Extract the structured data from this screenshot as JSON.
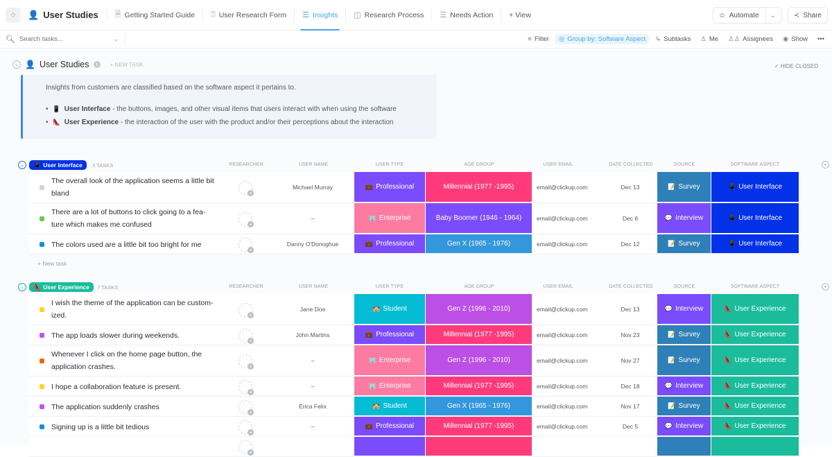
{
  "header": {
    "space_icon": "loading-spinner-icon",
    "title": "User Studies",
    "tabs": [
      {
        "label": "Getting Started Guide",
        "icon": "doc-icon",
        "active": false
      },
      {
        "label": "User Research Form",
        "icon": "form-icon",
        "active": false
      },
      {
        "label": "Insights",
        "icon": "list-icon",
        "active": true
      },
      {
        "label": "Research Process",
        "icon": "board-icon",
        "active": false
      },
      {
        "label": "Needs Action",
        "icon": "list-icon",
        "active": false
      }
    ],
    "add_view": "+ View",
    "automate": "Automate",
    "share": "Share"
  },
  "toolbar": {
    "search_placeholder": "Search tasks...",
    "filter": "Filter",
    "group_by": "Group by: Software Aspect",
    "subtasks": "Subtasks",
    "me": "Me",
    "assignees": "Assignees",
    "show": "Show",
    "more": "•••"
  },
  "list": {
    "title": "User Studies",
    "new_task": "+ NEW TASK",
    "hide_closed": "✓ HIDE CLOSED",
    "description": {
      "intro": "Insights from customers are classified based on the software aspect it pertains to.",
      "items": [
        {
          "icon": "📱",
          "term": "User Interface",
          "text": " - the buttons, images, and other visual items that users interact with when using the software"
        },
        {
          "icon": "👠",
          "term": "User Experience",
          "text": " - the interaction of the user with the product and/or their perceptions about the interaction"
        }
      ]
    }
  },
  "columns": [
    "RESEARCHER",
    "USER NAME",
    "USER TYPE",
    "AGE GROUP",
    "USER EMAIL",
    "DATE COLLECTED",
    "SOURCE",
    "SOFTWARE ASPECT"
  ],
  "colors": {
    "ui_badge": "#0231e8",
    "ux_badge": "#1bbc9c",
    "professional": "#7b4cfb",
    "enterprise": "#fd7ba3",
    "student": "#04bcd3",
    "millennial": "#fe3a7b",
    "baby_boomer": "#7b4cfb",
    "gen_x": "#3397dd",
    "gen_z": "#bb4fe6",
    "survey": "#2f80b8",
    "interview": "#7b4cfb"
  },
  "groups": [
    {
      "name": "User Interface",
      "icon": "📱",
      "count": "3 TASKS",
      "new_task": "+ New task",
      "tasks": [
        {
          "name": "The overall look of the application seems a little bit bland",
          "status_color": "#d3d3d3",
          "user_name": "Michael Murray",
          "user_type": "Professional",
          "user_type_icon": "💼",
          "age_group": "Millennial (1977 -1995)",
          "email": "email@clickup.com",
          "date": "Dec 13",
          "source": "Survey",
          "source_icon": "📝",
          "aspect": "User Interface"
        },
        {
          "name": "There are a lot of buttons to click going to a fea-ture which makes me confused",
          "status_color": "#6bc950",
          "user_name": "–",
          "user_type": "Enterprise",
          "user_type_icon": "🏢",
          "age_group": "Baby Boomer (1946 - 1964)",
          "email": "email@clickup.com",
          "date": "Dec 6",
          "source": "Interview",
          "source_icon": "💬",
          "aspect": "User Interface"
        },
        {
          "name": "The colors used are a little bit too bright for me",
          "status_color": "#1090e0",
          "user_name": "Danny O'Donoghue",
          "user_type": "Professional",
          "user_type_icon": "💼",
          "age_group": "Gen X (1965 - 1976)",
          "email": "email@clickup.com",
          "date": "Dec 12",
          "source": "Survey",
          "source_icon": "📝",
          "aspect": "User Interface"
        }
      ]
    },
    {
      "name": "User Experience",
      "icon": "👠",
      "count": "7 TASKS",
      "tasks": [
        {
          "name": "I wish the theme of the application can be custom-ized.",
          "status_color": "#f8d620",
          "user_name": "Jane Doe",
          "user_type": "Student",
          "user_type_icon": "🏫",
          "age_group": "Gen Z (1996 - 2010)",
          "email": "email@clickup.com",
          "date": "Dec 13",
          "source": "Interview",
          "source_icon": "💬",
          "aspect": "User Experience"
        },
        {
          "name": "The app loads slower during weekends.",
          "status_color": "#bf55ec",
          "user_name": "John Martins",
          "user_type": "Professional",
          "user_type_icon": "💼",
          "age_group": "Millennial (1977 -1995)",
          "email": "email@clickup.com",
          "date": "Nov 23",
          "source": "Survey",
          "source_icon": "📝",
          "aspect": "User Experience"
        },
        {
          "name": "Whenever I click on the home page button, the application crashes.",
          "status_color": "#e16b16",
          "user_name": "–",
          "user_type": "Enterprise",
          "user_type_icon": "🏢",
          "age_group": "Gen Z (1996 - 2010)",
          "email": "email@clickup.com",
          "date": "Nov 27",
          "source": "Survey",
          "source_icon": "📝",
          "aspect": "User Experience"
        },
        {
          "name": "I hope a collaboration feature is present.",
          "status_color": "#f8d620",
          "user_name": "–",
          "user_type": "Enterprise",
          "user_type_icon": "🏢",
          "age_group": "Millennial (1977 -1995)",
          "email": "email@clickup.com",
          "date": "Dec 18",
          "source": "Interview",
          "source_icon": "💬",
          "aspect": "User Experience"
        },
        {
          "name": "The application suddenly crashes",
          "status_color": "#bf55ec",
          "user_name": "Erica Felix",
          "user_type": "Student",
          "user_type_icon": "🏫",
          "age_group": "Gen X (1965 - 1976)",
          "email": "email@clickup.com",
          "date": "Nov 17",
          "source": "Survey",
          "source_icon": "📝",
          "aspect": "User Experience"
        },
        {
          "name": "Signing up is a little bit tedious",
          "status_color": "#1090e0",
          "user_name": "–",
          "user_type": "Professional",
          "user_type_icon": "💼",
          "age_group": "Millennial (1977 -1995)",
          "email": "email@clickup.com",
          "date": "Dec 5",
          "source": "Interview",
          "source_icon": "💬",
          "aspect": "User Experience"
        },
        {
          "name": "",
          "status_color": "#ffffff",
          "user_name": "",
          "user_type": "",
          "user_type_icon": "",
          "age_group": "",
          "email": "",
          "date": "",
          "source": "",
          "source_icon": "",
          "aspect": "",
          "partial": true,
          "user_type_color": "professional",
          "age_color": "millennial",
          "source_color": "survey"
        }
      ]
    }
  ]
}
